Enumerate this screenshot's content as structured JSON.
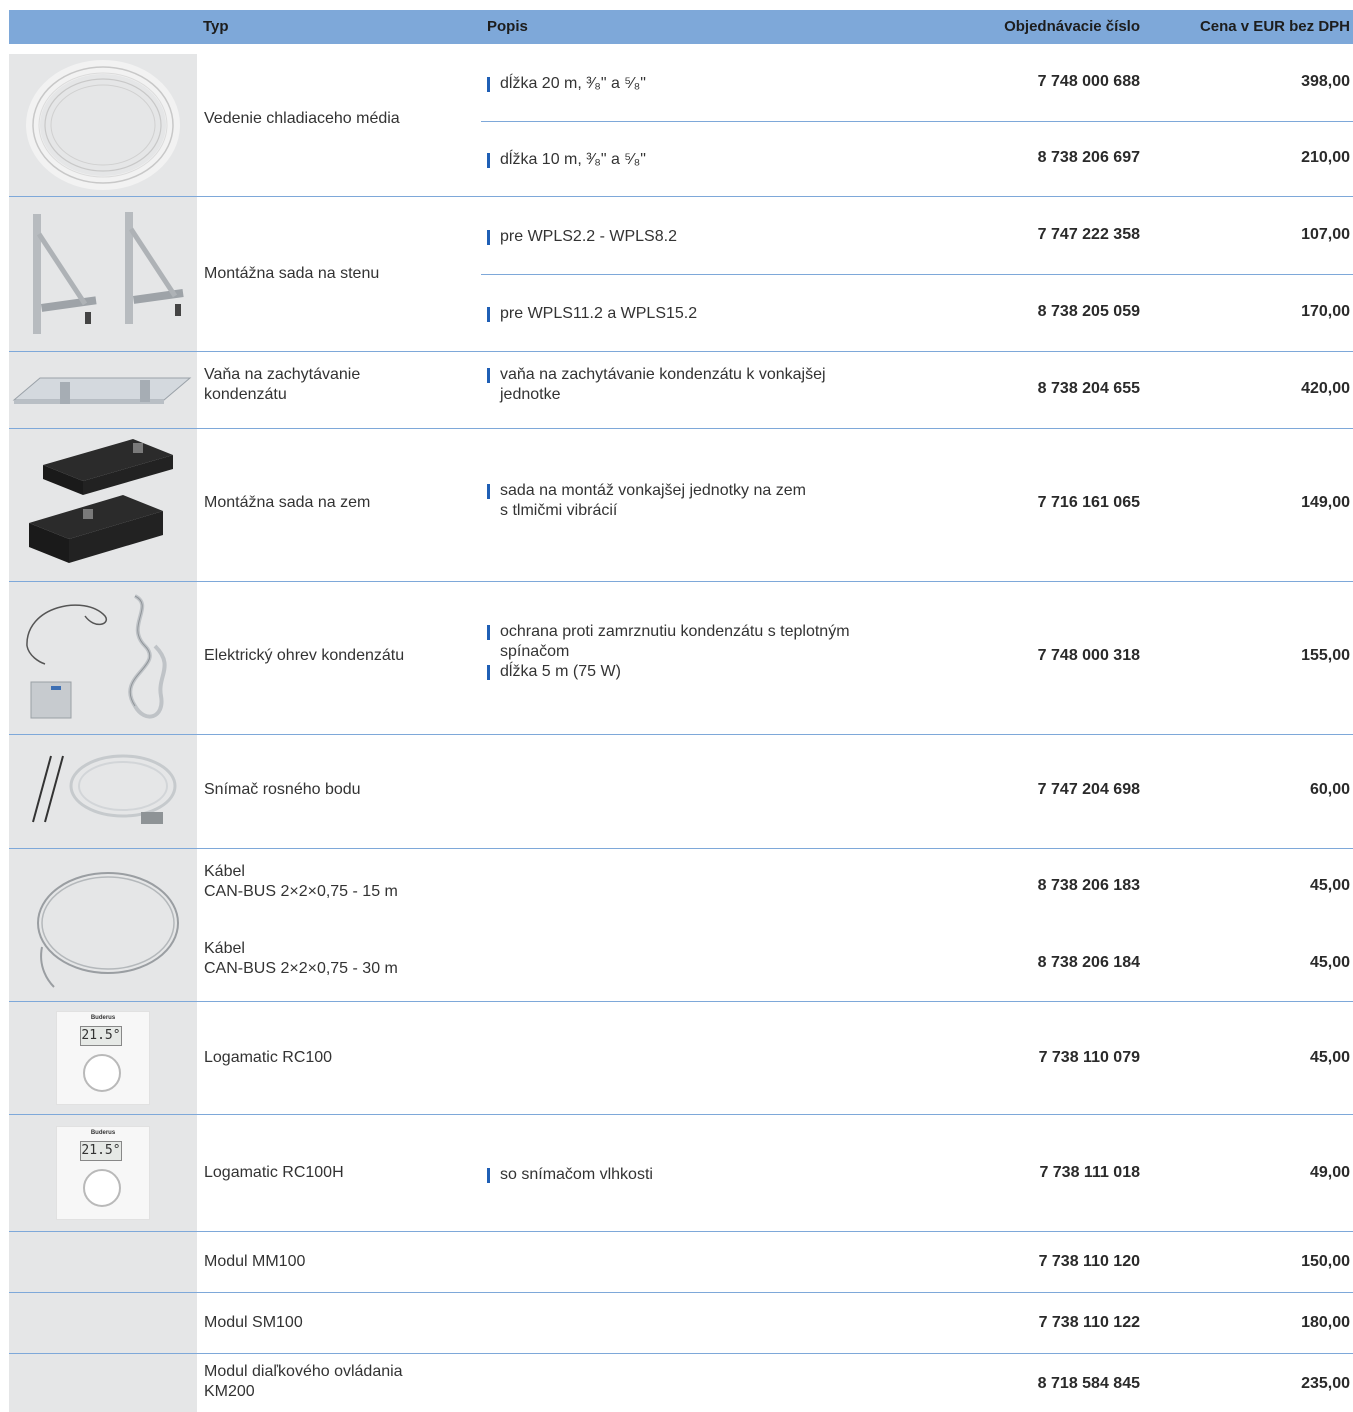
{
  "header": {
    "typ": "Typ",
    "popis": "Popis",
    "order_number": "Objednávacie číslo",
    "price": "Cena v EUR bez DPH"
  },
  "rows": [
    {
      "type": "Vedenie chladiaceho média",
      "image": "coiled-pipe-image",
      "variants": [
        {
          "desc": "dĺžka 20 m, ³⁄₈\" a ⁵⁄₈\"",
          "number": "7 748 000 688",
          "price": "398,00"
        },
        {
          "desc": "dĺžka 10 m, ³⁄₈\" a ⁵⁄₈\"",
          "number": "8 738 206 697",
          "price": "210,00"
        }
      ]
    },
    {
      "type": "Montážna sada na stenu",
      "image": "wall-bracket-image",
      "variants": [
        {
          "desc": "pre WPLS2.2 - WPLS8.2",
          "number": "7 747 222 358",
          "price": "107,00"
        },
        {
          "desc": "pre WPLS11.2 a WPLS15.2",
          "number": "8 738 205 059",
          "price": "170,00"
        }
      ]
    },
    {
      "type": "Vaňa na zachytávanie\nkondenzátu",
      "image": "condensate-tray-image",
      "desc": [
        "vaňa na zachytávanie kondenzátu k vonkajšej\njednotke"
      ],
      "number": "8 738 204 655",
      "price": "420,00"
    },
    {
      "type": "Montážna sada na zem",
      "image": "floor-mount-image",
      "desc": [
        "sada na montáž vonkajšej jednotky na zem\ns tlmičmi vibrácií"
      ],
      "number": "7 716 161 065",
      "price": "149,00"
    },
    {
      "type": "Elektrický ohrev kondenzátu",
      "image": "heating-cable-image",
      "desc": [
        "ochrana proti zamrznutiu kondenzátu s teplotným\nspínačom",
        "dĺžka 5 m (75 W)"
      ],
      "number": "7 748 000 318",
      "price": "155,00"
    },
    {
      "type": "Snímač rosného bodu",
      "image": "dew-point-sensor-image",
      "number": "7 747 204 698",
      "price": "60,00"
    },
    {
      "type": "",
      "image": "cable-coil-image",
      "variants": [
        {
          "type": "Kábel\nCAN-BUS 2×2×0,75 - 15 m",
          "number": "8 738 206 183",
          "price": "45,00"
        },
        {
          "type": "Kábel\nCAN-BUS 2×2×0,75 - 30 m",
          "number": "8 738 206 184",
          "price": "45,00"
        }
      ]
    },
    {
      "type": "Logamatic RC100",
      "image": "controller-image",
      "brand": "Buderus",
      "display": "21.5°",
      "number": "7 738 110 079",
      "price": "45,00"
    },
    {
      "type": "Logamatic RC100H",
      "image": "controller-image",
      "brand": "Buderus",
      "display": "21.5°",
      "desc": [
        "so snímačom vlhkosti"
      ],
      "number": "7 738 111 018",
      "price": "49,00"
    },
    {
      "type": "Modul MM100",
      "number": "7 738 110 120",
      "price": "150,00"
    },
    {
      "type": "Modul SM100",
      "number": "7 738 110 122",
      "price": "180,00"
    },
    {
      "type": "Modul diaľkového ovládania\nKM200",
      "number": "8 718 584 845",
      "price": "235,00"
    }
  ]
}
